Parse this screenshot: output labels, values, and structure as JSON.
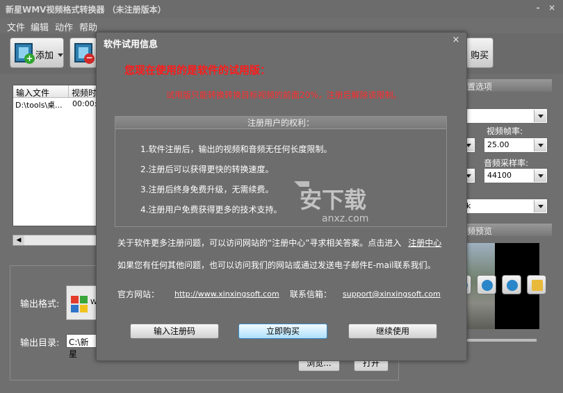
{
  "app": {
    "title": "新星WMV视频格式转换器 （未注册版本）",
    "menu": [
      "文件",
      "编辑",
      "动作",
      "帮助"
    ],
    "toolbar": {
      "add_label": "添加",
      "buy_label": "购买"
    },
    "filelist": {
      "headers": [
        "输入文件",
        "视频时"
      ],
      "rows": [
        [
          "D:\\tools\\桌...",
          "00:00:"
        ]
      ]
    },
    "output": {
      "format_label": "输出格式:",
      "format_value": "WM",
      "dir_label": "输出目录:",
      "dir_value": "C:\\新星",
      "browse_label": "浏览...",
      "open_label": "打开"
    },
    "right_panel": {
      "options_header": "置选项",
      "framerate_label": "视频帧率:",
      "framerate_value": "25.00",
      "samplerate_label": "音频采样率:",
      "samplerate_value": "44100",
      "combo3_value": "k",
      "preview_header": "频预览"
    },
    "win_controls": [
      "-",
      "×"
    ]
  },
  "dialog": {
    "title": "软件试用信息",
    "close": "×",
    "headline": "您现在使用的是软件的试用版：",
    "subline": "试用版只能转换转换目标视频的前面20%，注册后解除该限制。",
    "rights_header": "注册用户的权利：",
    "rights": [
      "1.软件注册后，输出的视频和音频无任何长度限制。",
      "2.注册后可以获得更快的转换速度。",
      "3.注册后终身免费升级，无需续费。",
      "4.注册用户免费获得更多的技术支持。"
    ],
    "para1": "关于软件更多注册问题，可以访问网站的“注册中心”寻求相关答案。点击进入",
    "para1_link": "注册中心",
    "para2": "如果您有任何其他问题，也可以访问我们的网站或通过发送电子邮件E-mail联系我们。",
    "site_label": "官方网站：",
    "site_url": "http://www.xinxingsoft.com",
    "mail_label": "联系信箱：",
    "mail": "support@xinxingsoft.com",
    "buttons": [
      "输入注册码",
      "立即购买",
      "继续使用"
    ]
  },
  "watermark": {
    "text": "安下载",
    "sub": "anxz.com"
  }
}
